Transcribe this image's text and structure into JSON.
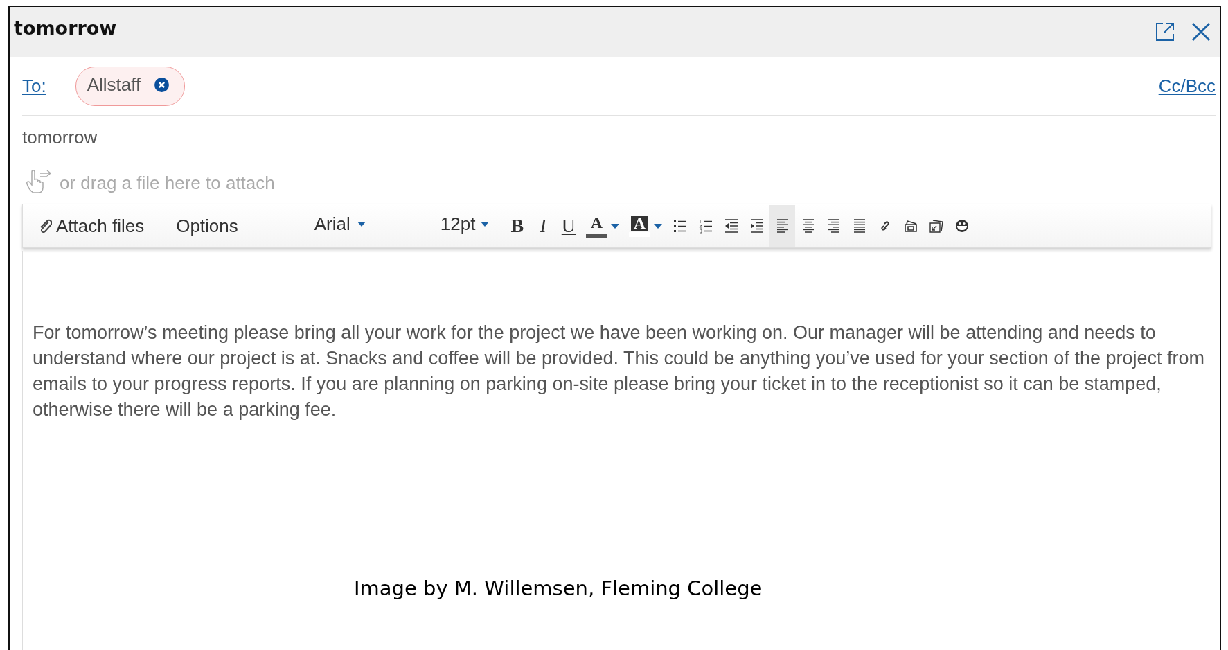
{
  "window": {
    "title": "tomorrow"
  },
  "to": {
    "label": "To:",
    "recipients": [
      {
        "name": "Allstaff"
      }
    ],
    "cc_bcc": "Cc/Bcc"
  },
  "subject": {
    "value": "tomorrow"
  },
  "attach_hint": {
    "placeholder": "or drag a file here to attach"
  },
  "toolbar": {
    "attach": "Attach files",
    "options": "Options",
    "font": "Arial",
    "size": "12pt",
    "format_buttons": [
      {
        "kind": "bold",
        "glyph": "B",
        "selected": false
      },
      {
        "kind": "italic",
        "glyph": "I",
        "selected": false
      },
      {
        "kind": "underline",
        "glyph": "U",
        "selected": false
      },
      {
        "kind": "font-color",
        "glyph": "A",
        "selected": false
      },
      {
        "kind": "highlight",
        "glyph": "A",
        "selected": false
      },
      {
        "kind": "bullets",
        "selected": false
      },
      {
        "kind": "numbering",
        "selected": false
      },
      {
        "kind": "outdent",
        "selected": false
      },
      {
        "kind": "indent",
        "selected": false
      },
      {
        "kind": "align-left",
        "selected": true
      },
      {
        "kind": "align-center",
        "selected": false
      },
      {
        "kind": "align-right",
        "selected": false
      },
      {
        "kind": "justify",
        "selected": false
      },
      {
        "kind": "link",
        "selected": false
      },
      {
        "kind": "image",
        "selected": false
      },
      {
        "kind": "signature",
        "selected": false
      },
      {
        "kind": "emoji",
        "selected": false
      }
    ]
  },
  "body": {
    "text": "For tomorrow’s meeting please bring all your work for the project we have been working on. Our manager will be attending and needs to understand where our project is at. Snacks and coffee will be provided. This could be anything you’ve used for your section of the project from emails to your progress reports. If you are planning on parking on-site please bring your ticket in to the receptionist so it can be stamped, otherwise there will be a parking fee."
  },
  "image_credit": "Image by M. Willemsen, Fleming College"
}
